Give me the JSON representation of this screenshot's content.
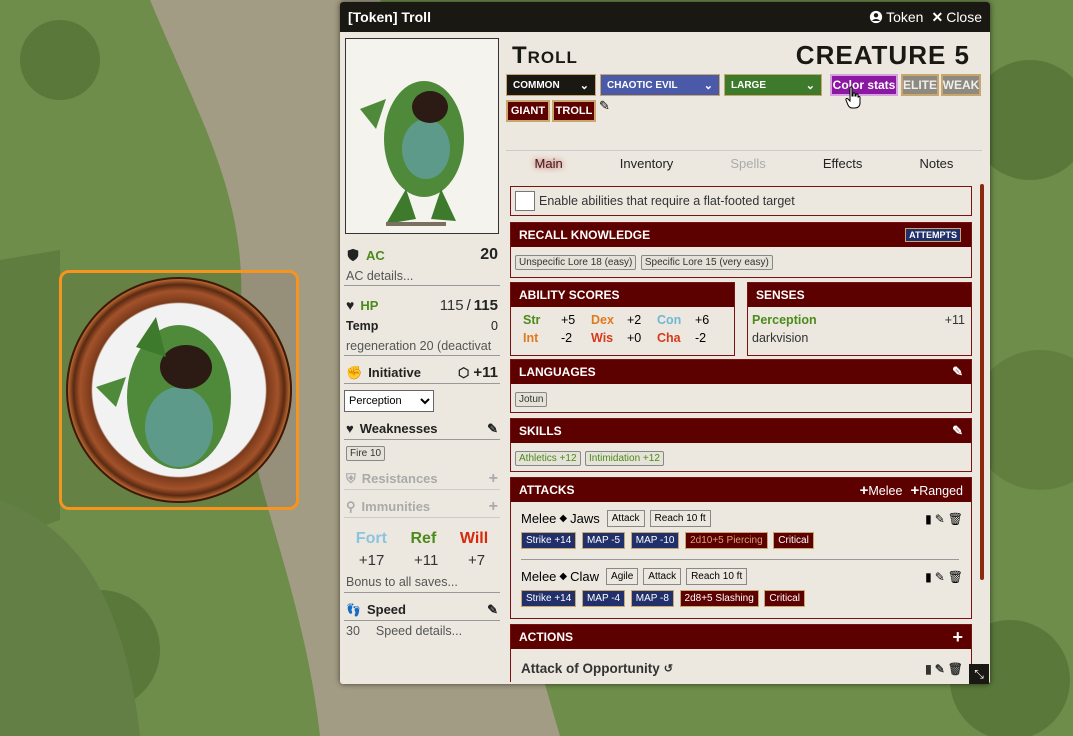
{
  "window": {
    "title": "[Token] Troll",
    "token_label": "Token",
    "close_label": "Close"
  },
  "creature": {
    "name": "Troll",
    "level_label": "CREATURE 5",
    "rarity": "COMMON",
    "alignment": "CHAOTIC EVIL",
    "size": "LARGE",
    "traits": [
      "GIANT",
      "TROLL"
    ]
  },
  "buttons": {
    "color_stats": "Color stats",
    "elite": "ELITE",
    "weak": "WEAK"
  },
  "tabs": [
    {
      "label": "Main",
      "state": "active"
    },
    {
      "label": "Inventory",
      "state": "normal"
    },
    {
      "label": "Spells",
      "state": "disabled"
    },
    {
      "label": "Effects",
      "state": "normal"
    },
    {
      "label": "Notes",
      "state": "normal"
    }
  ],
  "left": {
    "ac_label": "AC",
    "ac_value": "20",
    "ac_details": "AC details...",
    "hp_label": "HP",
    "hp_value": "115",
    "hp_max": "115",
    "hp_sep": "/",
    "temp_label": "Temp",
    "temp_value": "0",
    "regen_text": "regeneration 20 (deactivat",
    "initiative_label": "Initiative",
    "initiative_value": "+11",
    "initiative_select": "Perception",
    "weaknesses_label": "Weaknesses",
    "weakness_tag": "Fire 10",
    "resistances_label": "Resistances",
    "immunities_label": "Immunities",
    "fort_label": "Fort",
    "fort_value": "+17",
    "ref_label": "Ref",
    "ref_value": "+11",
    "will_label": "Will",
    "will_value": "+7",
    "saves_bonus": "Bonus to all saves...",
    "speed_label": "Speed",
    "speed_value": "30",
    "speed_details": "Speed details..."
  },
  "flat_footed_label": "Enable abilities that require a flat-footed target",
  "recall": {
    "title": "RECALL KNOWLEDGE",
    "attempts": "ATTEMPTS",
    "tags": [
      "Unspecific Lore 18 (easy)",
      "Specific Lore 15 (very easy)"
    ]
  },
  "abilities": {
    "title": "ABILITY SCORES",
    "scores": [
      {
        "name": "Str",
        "mod": "+5",
        "color": "#4d8a1c"
      },
      {
        "name": "Dex",
        "mod": "+2",
        "color": "#e07a1f"
      },
      {
        "name": "Con",
        "mod": "+6",
        "color": "#6fb8d6"
      },
      {
        "name": "Int",
        "mod": "-2",
        "color": "#e07a1f"
      },
      {
        "name": "Wis",
        "mod": "+0",
        "color": "#d63a1a"
      },
      {
        "name": "Cha",
        "mod": "-2",
        "color": "#d63a1a"
      }
    ]
  },
  "senses": {
    "title": "SENSES",
    "perception_label": "Perception",
    "perception_value": "+11",
    "other": "darkvision"
  },
  "languages": {
    "title": "LANGUAGES",
    "tags": [
      "Jotun"
    ]
  },
  "skills": {
    "title": "SKILLS",
    "tags": [
      "Athletics +12",
      "Intimidation +12"
    ]
  },
  "attacks": {
    "title": "ATTACKS",
    "melee_btn": "Melee",
    "ranged_btn": "Ranged",
    "items": [
      {
        "type": "Melee",
        "name": "Jaws",
        "traits": [
          "Attack",
          "Reach 10 ft"
        ],
        "strike": "Strike +14",
        "map1": "MAP -5",
        "map2": "MAP -10",
        "damage": "2d10+5 Piercing",
        "critical": "Critical"
      },
      {
        "type": "Melee",
        "name": "Claw",
        "traits": [
          "Agile",
          "Attack",
          "Reach 10 ft"
        ],
        "strike": "Strike +14",
        "map1": "MAP -4",
        "map2": "MAP -8",
        "damage": "2d8+5 Slashing",
        "critical": "Critical"
      }
    ]
  },
  "actions": {
    "title": "ACTIONS",
    "items": [
      {
        "name": "Attack of Opportunity"
      }
    ]
  },
  "colors": {
    "header_red": "#5d0000",
    "accent_blue": "#21306b",
    "titlebar": "#191813",
    "token_border": "#f7941d"
  }
}
